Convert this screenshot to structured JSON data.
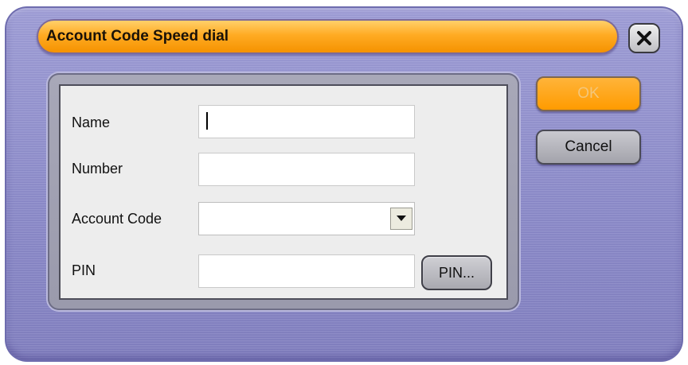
{
  "dialog": {
    "title": "Account Code Speed dial",
    "close_icon": "close-x-icon"
  },
  "form": {
    "name_label": "Name",
    "name_value": "",
    "number_label": "Number",
    "number_value": "",
    "account_code_label": "Account Code",
    "account_code_value": "",
    "account_code_dropdown_icon": "chevron-down-icon",
    "pin_label": "PIN",
    "pin_value": "",
    "pin_button_label": "PIN..."
  },
  "actions": {
    "ok_label": "OK",
    "cancel_label": "Cancel"
  },
  "colors": {
    "title_bar": "#ffab23",
    "dialog_background": "#8a89c9",
    "ok_button": "#ff9b00",
    "ok_text_disabled": "#f4c67a"
  }
}
